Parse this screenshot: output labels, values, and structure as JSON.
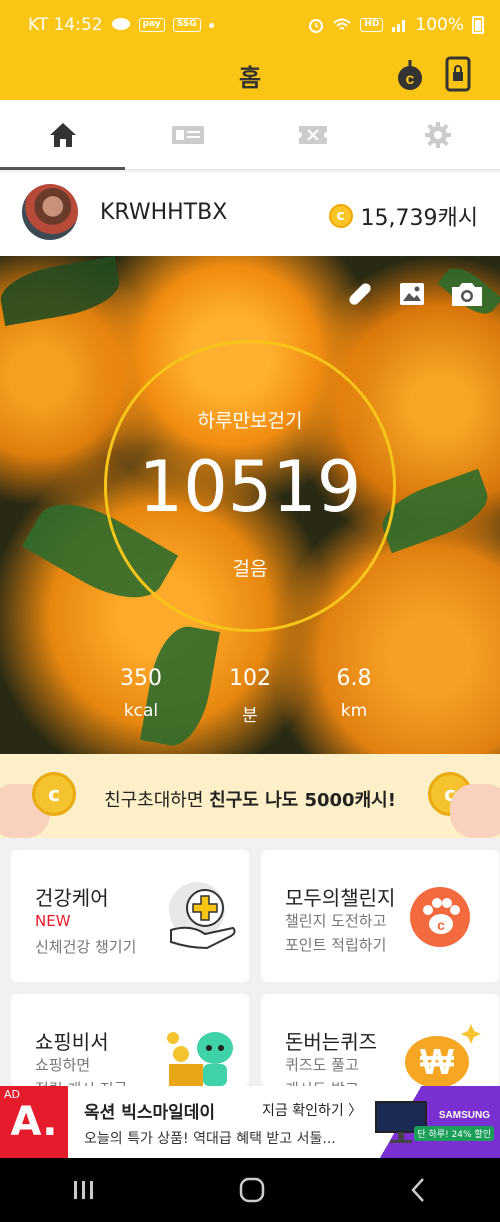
{
  "status_bar": {
    "carrier_time": "KT 14:52",
    "mini_badges": [
      "pay",
      "SSG"
    ],
    "network_badge": "HD",
    "battery": "100%"
  },
  "header": {
    "title": "홈"
  },
  "tabs": [
    {
      "icon": "home-icon",
      "active": true
    },
    {
      "icon": "ticket-icon",
      "active": false
    },
    {
      "icon": "coupon-icon",
      "active": false
    },
    {
      "icon": "gear-icon",
      "active": false
    }
  ],
  "profile": {
    "username": "KRWHHTBX",
    "coin_symbol": "c",
    "cash": "15,739캐시"
  },
  "pedometer": {
    "label": "하루만보걷기",
    "steps": "10519",
    "steps_unit": "걸음",
    "stats": [
      {
        "value": "350",
        "unit": "kcal"
      },
      {
        "value": "102",
        "unit": "분"
      },
      {
        "value": "6.8",
        "unit": "km"
      }
    ]
  },
  "invite": {
    "text_normal": "친구초대하면 ",
    "text_bold": "친구도 나도 5000캐시!",
    "coin_symbol": "c"
  },
  "cards": [
    {
      "title": "건강케어",
      "badge": "NEW",
      "desc": "신체건강 챙기기"
    },
    {
      "title": "모두의챌린지",
      "desc1": "챌린지 도전하고",
      "desc2": "포인트 적립하기"
    },
    {
      "title": "쇼핑비서",
      "desc1": "쇼핑하면",
      "desc2": "적립 캐시 지급"
    },
    {
      "title": "돈버는퀴즈",
      "desc1": "퀴즈도 풀고",
      "desc2": "캐시도 받고"
    }
  ],
  "ad": {
    "tag": "AD",
    "logo": "A.",
    "title": "옥션 빅스마일데이",
    "cta": "지금 확인하기 〉",
    "desc": "오늘의 특가 상품! 역대급 혜택 받고 서둘...",
    "brand": "SAMSUNG",
    "promo": "단 하루! 24% 할인"
  },
  "colors": {
    "brand_yellow": "#fac515",
    "ring": "#f5c51a",
    "new_badge": "#e51c2c",
    "ad_red": "#e51c2c"
  }
}
